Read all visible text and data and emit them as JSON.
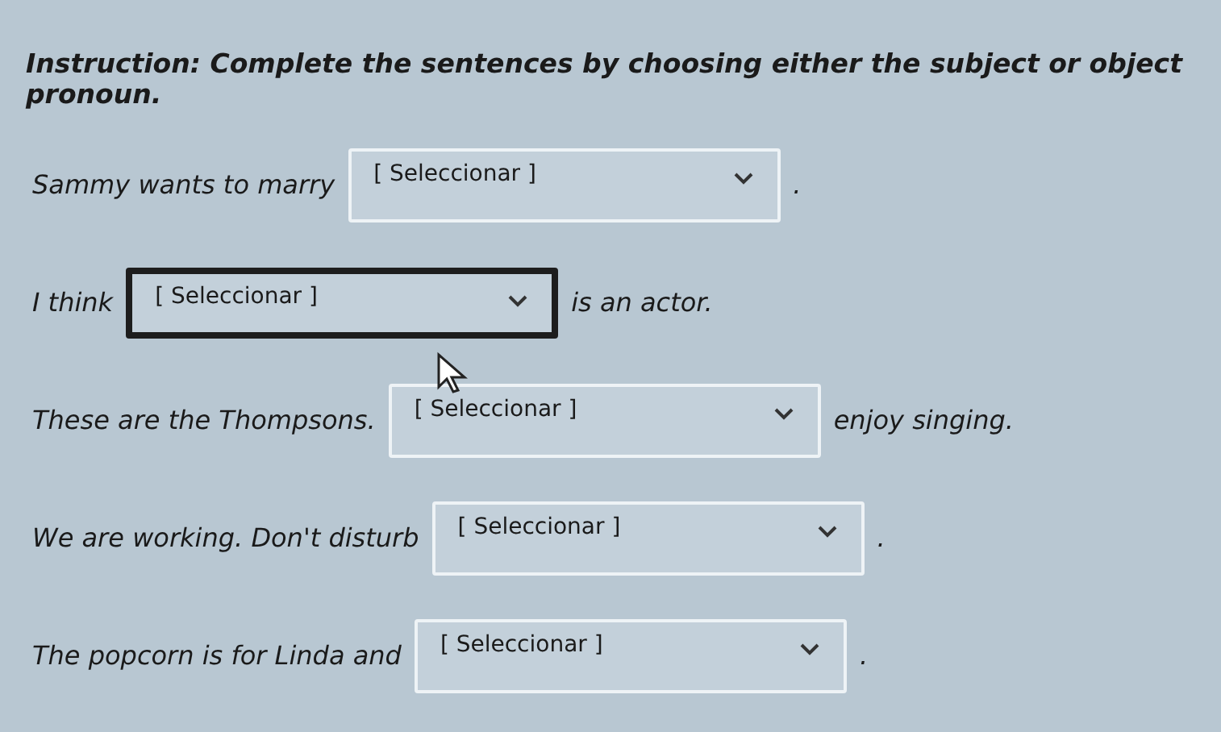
{
  "instruction": {
    "label": "Instruction:",
    "text": "Complete the sentences by choosing either the subject or object pronoun."
  },
  "questions": [
    {
      "before": "Sammy wants to marry",
      "select": "[ Seleccionar ]",
      "focused": false,
      "after": "."
    },
    {
      "before": "I think",
      "select": "[ Seleccionar ]",
      "focused": true,
      "after": "is an actor."
    },
    {
      "before": "These are the Thompsons.",
      "select": "[ Seleccionar ]",
      "focused": false,
      "after": "enjoy singing."
    },
    {
      "before": "We are working. Don't disturb",
      "select": "[ Seleccionar ]",
      "focused": false,
      "after": "."
    },
    {
      "before": "The popcorn is for Linda and",
      "select": "[ Seleccionar ]",
      "focused": false,
      "after": "."
    }
  ]
}
